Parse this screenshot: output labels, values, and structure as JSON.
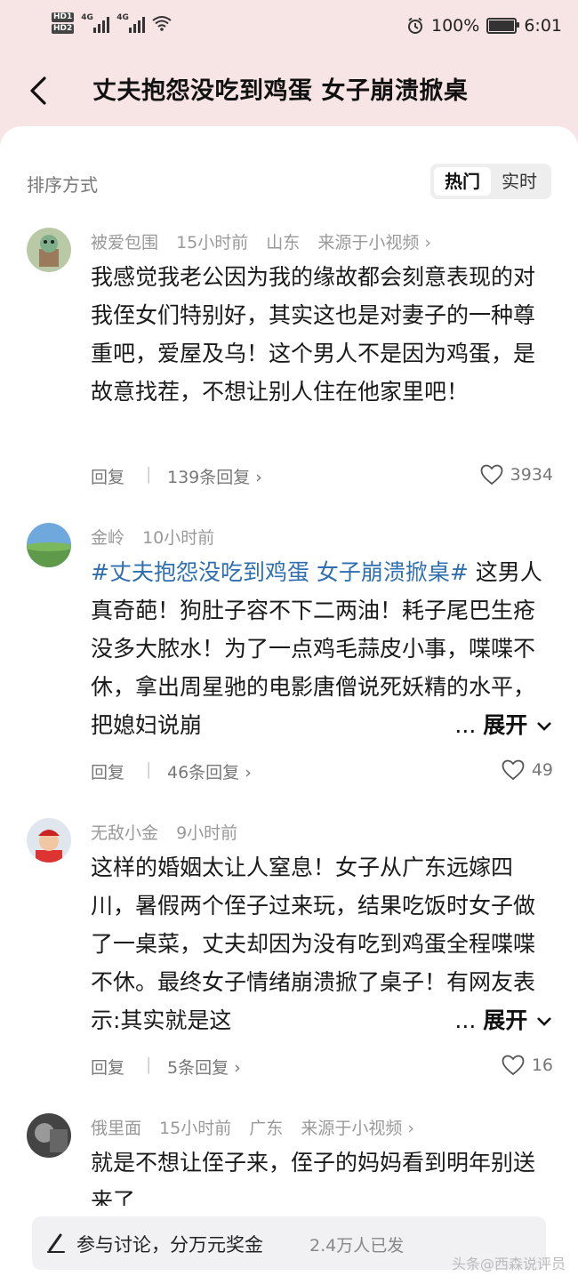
{
  "status_bar": {
    "hd1": "HD1",
    "hd2": "HD2",
    "net1": "4G",
    "net2": "4G",
    "battery": "100%",
    "time": "6:01"
  },
  "header": {
    "title": "丈夫抱怨没吃到鸡蛋 女子崩溃掀桌"
  },
  "sort": {
    "label": "排序方式",
    "options": [
      "热门",
      "实时"
    ],
    "selected": "热门"
  },
  "comments": [
    {
      "user": "被爱包围",
      "time": "15小时前",
      "location": "山东",
      "source": "来源于小视频 ›",
      "text": "我感觉我老公因为我的缘故都会刻意表现的对我侄女们特别好，其实这也是对妻子的一种尊重吧，爱屋及乌！这个男人不是因为鸡蛋，是故意找茬，不想让别人住在他家里吧！",
      "reply_label": "回复",
      "reply_count": "139条回复 ›",
      "likes": "3934"
    },
    {
      "user": "金岭",
      "time": "10小时前",
      "hashtag": "#丈夫抱怨没吃到鸡蛋 女子崩溃掀桌#",
      "text": "这男人真奇葩！狗肚子容不下二两油！耗子尾巴生疮没多大脓水！为了一点鸡毛蒜皮小事，喋喋不休，拿出周星驰的电影唐僧说死妖精的水平，把媳妇说崩",
      "expand": "展开",
      "reply_label": "回复",
      "reply_count": "46条回复 ›",
      "likes": "49"
    },
    {
      "user": "无敌小金",
      "time": "9小时前",
      "text": "这样的婚姻太让人窒息！女子从广东远嫁四川，暑假两个侄子过来玩，结果吃饭时女子做了一桌菜，丈夫却因为没有吃到鸡蛋全程喋喋不休。最终女子情绪崩溃掀了桌子！有网友表示:其实就是这",
      "expand": "展开",
      "reply_label": "回复",
      "reply_count": "5条回复 ›",
      "likes": "16"
    },
    {
      "user": "俄里面",
      "time": "15小时前",
      "location": "广东",
      "source": "来源于小视频 ›",
      "text": "就是不想让侄子来，侄子的妈妈看到明年别送来了"
    }
  ],
  "bottom_bar": {
    "cta": "参与讨论，分万元奖金",
    "count": "2.4万人已发"
  },
  "watermark": "头条@西森说评员"
}
